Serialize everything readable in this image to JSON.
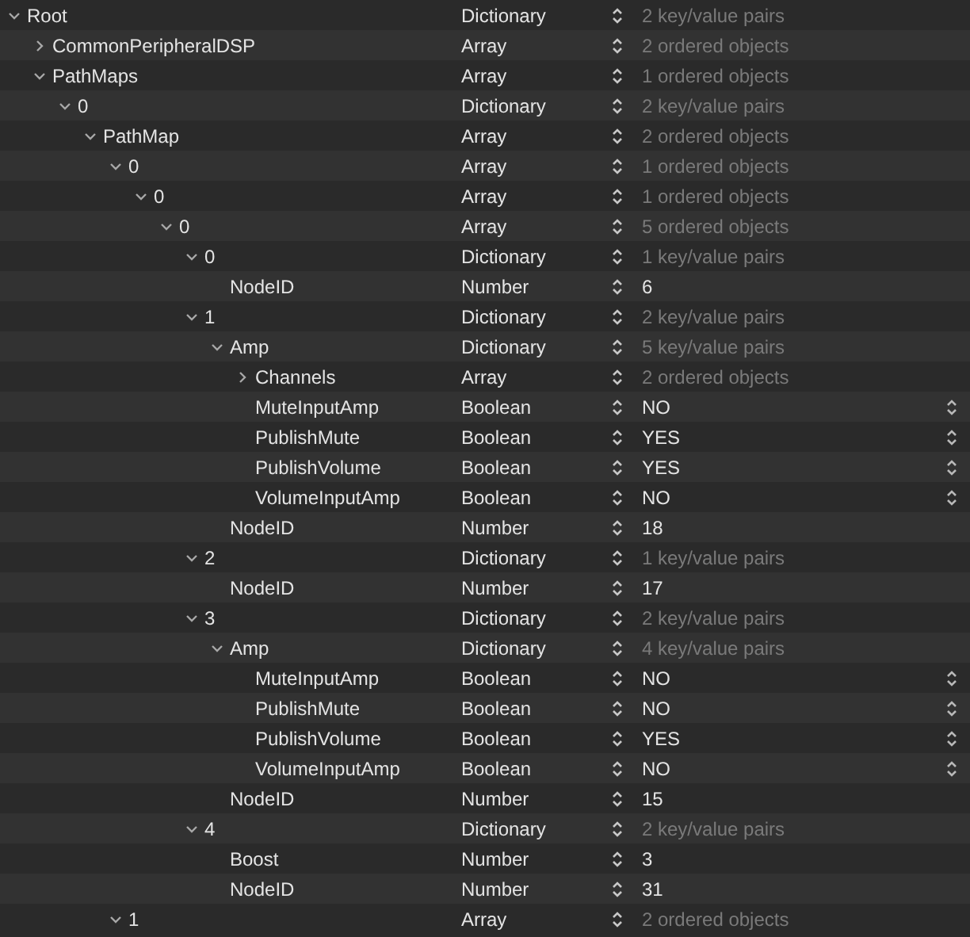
{
  "tree": [
    {
      "key": "Root",
      "type": "Dictionary",
      "value": "2 key/value pairs",
      "kind": "container",
      "expanded": true,
      "children": [
        {
          "key": "CommonPeripheralDSP",
          "type": "Array",
          "value": "2 ordered objects",
          "kind": "container",
          "expanded": false
        },
        {
          "key": "PathMaps",
          "type": "Array",
          "value": "1 ordered objects",
          "kind": "container",
          "expanded": true,
          "children": [
            {
              "key": "0",
              "type": "Dictionary",
              "value": "2 key/value pairs",
              "kind": "container",
              "expanded": true,
              "children": [
                {
                  "key": "PathMap",
                  "type": "Array",
                  "value": "2 ordered objects",
                  "kind": "container",
                  "expanded": true,
                  "children": [
                    {
                      "key": "0",
                      "type": "Array",
                      "value": "1 ordered objects",
                      "kind": "container",
                      "expanded": true,
                      "children": [
                        {
                          "key": "0",
                          "type": "Array",
                          "value": "1 ordered objects",
                          "kind": "container",
                          "expanded": true,
                          "children": [
                            {
                              "key": "0",
                              "type": "Array",
                              "value": "5 ordered objects",
                              "kind": "container",
                              "expanded": true,
                              "children": [
                                {
                                  "key": "0",
                                  "type": "Dictionary",
                                  "value": "1 key/value pairs",
                                  "kind": "container",
                                  "expanded": true,
                                  "children": [
                                    {
                                      "key": "NodeID",
                                      "type": "Number",
                                      "value": "6",
                                      "kind": "number"
                                    }
                                  ]
                                },
                                {
                                  "key": "1",
                                  "type": "Dictionary",
                                  "value": "2 key/value pairs",
                                  "kind": "container",
                                  "expanded": true,
                                  "children": [
                                    {
                                      "key": "Amp",
                                      "type": "Dictionary",
                                      "value": "5 key/value pairs",
                                      "kind": "container",
                                      "expanded": true,
                                      "children": [
                                        {
                                          "key": "Channels",
                                          "type": "Array",
                                          "value": "2 ordered objects",
                                          "kind": "container",
                                          "expanded": false
                                        },
                                        {
                                          "key": "MuteInputAmp",
                                          "type": "Boolean",
                                          "value": "NO",
                                          "kind": "boolean"
                                        },
                                        {
                                          "key": "PublishMute",
                                          "type": "Boolean",
                                          "value": "YES",
                                          "kind": "boolean"
                                        },
                                        {
                                          "key": "PublishVolume",
                                          "type": "Boolean",
                                          "value": "YES",
                                          "kind": "boolean"
                                        },
                                        {
                                          "key": "VolumeInputAmp",
                                          "type": "Boolean",
                                          "value": "NO",
                                          "kind": "boolean"
                                        }
                                      ]
                                    },
                                    {
                                      "key": "NodeID",
                                      "type": "Number",
                                      "value": "18",
                                      "kind": "number"
                                    }
                                  ]
                                },
                                {
                                  "key": "2",
                                  "type": "Dictionary",
                                  "value": "1 key/value pairs",
                                  "kind": "container",
                                  "expanded": true,
                                  "children": [
                                    {
                                      "key": "NodeID",
                                      "type": "Number",
                                      "value": "17",
                                      "kind": "number"
                                    }
                                  ]
                                },
                                {
                                  "key": "3",
                                  "type": "Dictionary",
                                  "value": "2 key/value pairs",
                                  "kind": "container",
                                  "expanded": true,
                                  "children": [
                                    {
                                      "key": "Amp",
                                      "type": "Dictionary",
                                      "value": "4 key/value pairs",
                                      "kind": "container",
                                      "expanded": true,
                                      "children": [
                                        {
                                          "key": "MuteInputAmp",
                                          "type": "Boolean",
                                          "value": "NO",
                                          "kind": "boolean"
                                        },
                                        {
                                          "key": "PublishMute",
                                          "type": "Boolean",
                                          "value": "NO",
                                          "kind": "boolean"
                                        },
                                        {
                                          "key": "PublishVolume",
                                          "type": "Boolean",
                                          "value": "YES",
                                          "kind": "boolean"
                                        },
                                        {
                                          "key": "VolumeInputAmp",
                                          "type": "Boolean",
                                          "value": "NO",
                                          "kind": "boolean"
                                        }
                                      ]
                                    },
                                    {
                                      "key": "NodeID",
                                      "type": "Number",
                                      "value": "15",
                                      "kind": "number"
                                    }
                                  ]
                                },
                                {
                                  "key": "4",
                                  "type": "Dictionary",
                                  "value": "2 key/value pairs",
                                  "kind": "container",
                                  "expanded": true,
                                  "children": [
                                    {
                                      "key": "Boost",
                                      "type": "Number",
                                      "value": "3",
                                      "kind": "number"
                                    },
                                    {
                                      "key": "NodeID",
                                      "type": "Number",
                                      "value": "31",
                                      "kind": "number"
                                    }
                                  ]
                                }
                              ]
                            }
                          ]
                        }
                      ]
                    },
                    {
                      "key": "1",
                      "type": "Array",
                      "value": "2 ordered objects",
                      "kind": "container",
                      "expanded": true
                    }
                  ]
                }
              ]
            }
          ]
        }
      ]
    }
  ]
}
